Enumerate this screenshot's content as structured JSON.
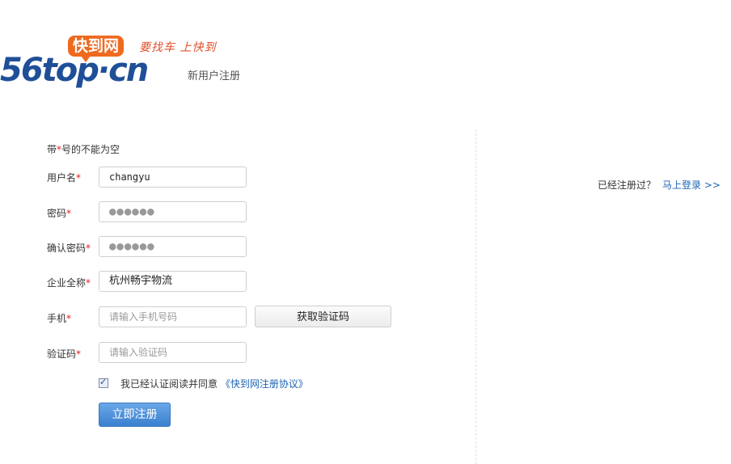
{
  "header": {
    "logo_main": "56top·cn",
    "logo_badge": "快到网",
    "logo_slogan": "要找车 上快到",
    "subtitle": "新用户注册"
  },
  "form": {
    "required_note_prefix": "带",
    "required_note_star": "*",
    "required_note_suffix": "号的不能为空",
    "fields": {
      "username": {
        "label": "用户名",
        "value": "changyu"
      },
      "password": {
        "label": "密码",
        "value": "●●●●●●"
      },
      "confirm_password": {
        "label": "确认密码",
        "value": "●●●●●●"
      },
      "company": {
        "label": "企业全称",
        "value": "杭州畅宇物流"
      },
      "phone": {
        "label": "手机",
        "placeholder": "请输入手机号码"
      },
      "code": {
        "label": "验证码",
        "placeholder": "请输入验证码"
      }
    },
    "star": "*",
    "sms_button": "获取验证码",
    "agree_text": "我已经认证阅读并同意",
    "agree_link": "《快到网注册协议》",
    "agree_checked": true,
    "submit": "立即注册"
  },
  "side": {
    "prompt": "已经注册过？",
    "login_link": "马上登录 >>"
  },
  "colors": {
    "brand_blue": "#1f4f97",
    "brand_orange": "#ee6a1f",
    "link": "#1f64b3",
    "required": "#e02020"
  }
}
